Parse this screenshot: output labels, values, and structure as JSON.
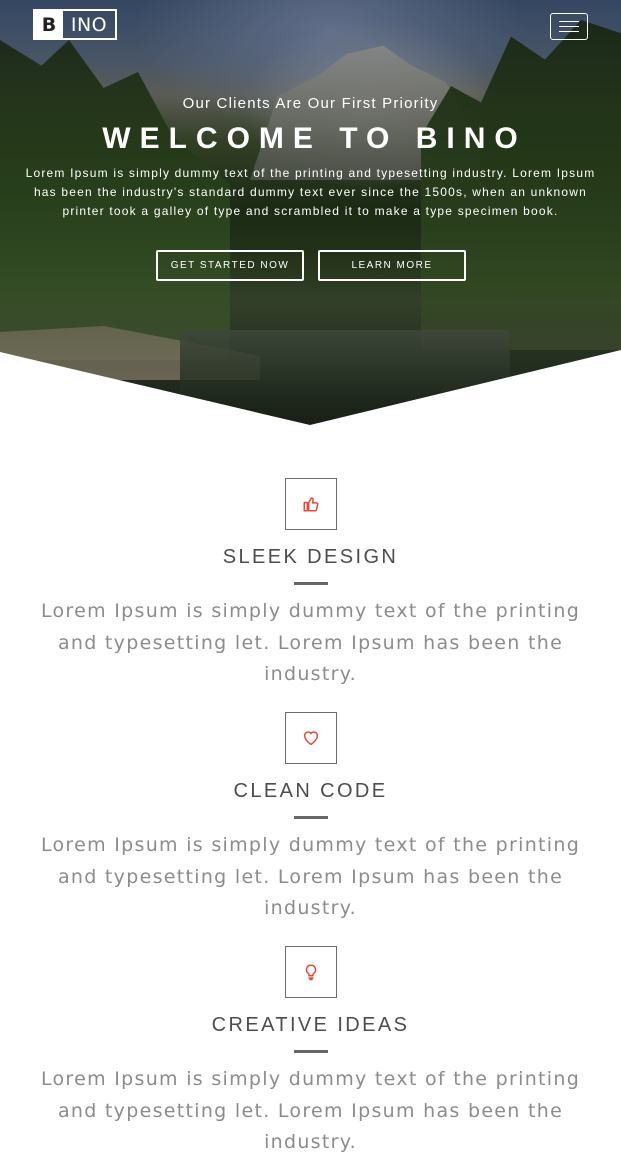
{
  "header": {
    "logo_first": "B",
    "logo_rest": "INO"
  },
  "hero": {
    "tagline": "Our Clients Are Our First Priority",
    "title": "WELCOME TO BINO",
    "description": "Lorem Ipsum is simply dummy text of the printing and typesetting industry. Lorem Ipsum has been the industry's standard dummy text ever since the 1500s, when an unknown printer took a galley of type and scrambled it to make a type specimen book.",
    "primary_button": "GET STARTED NOW",
    "secondary_button": "LEARN MORE"
  },
  "features": [
    {
      "icon": "thumbs-up-icon",
      "title": "SLEEK DESIGN",
      "text": "Lorem Ipsum is simply dummy text of the printing and typesetting let. Lorem Ipsum has been the industry."
    },
    {
      "icon": "heart-icon",
      "title": "CLEAN CODE",
      "text": "Lorem Ipsum is simply dummy text of the printing and typesetting let. Lorem Ipsum has been the industry."
    },
    {
      "icon": "lightbulb-icon",
      "title": "CREATIVE IDEAS",
      "text": "Lorem Ipsum is simply dummy text of the printing and typesetting let. Lorem Ipsum has been the industry."
    }
  ],
  "colors": {
    "accent": "#e24b3b",
    "heading": "#4d4d4d",
    "body_text": "#8c8c8c"
  }
}
